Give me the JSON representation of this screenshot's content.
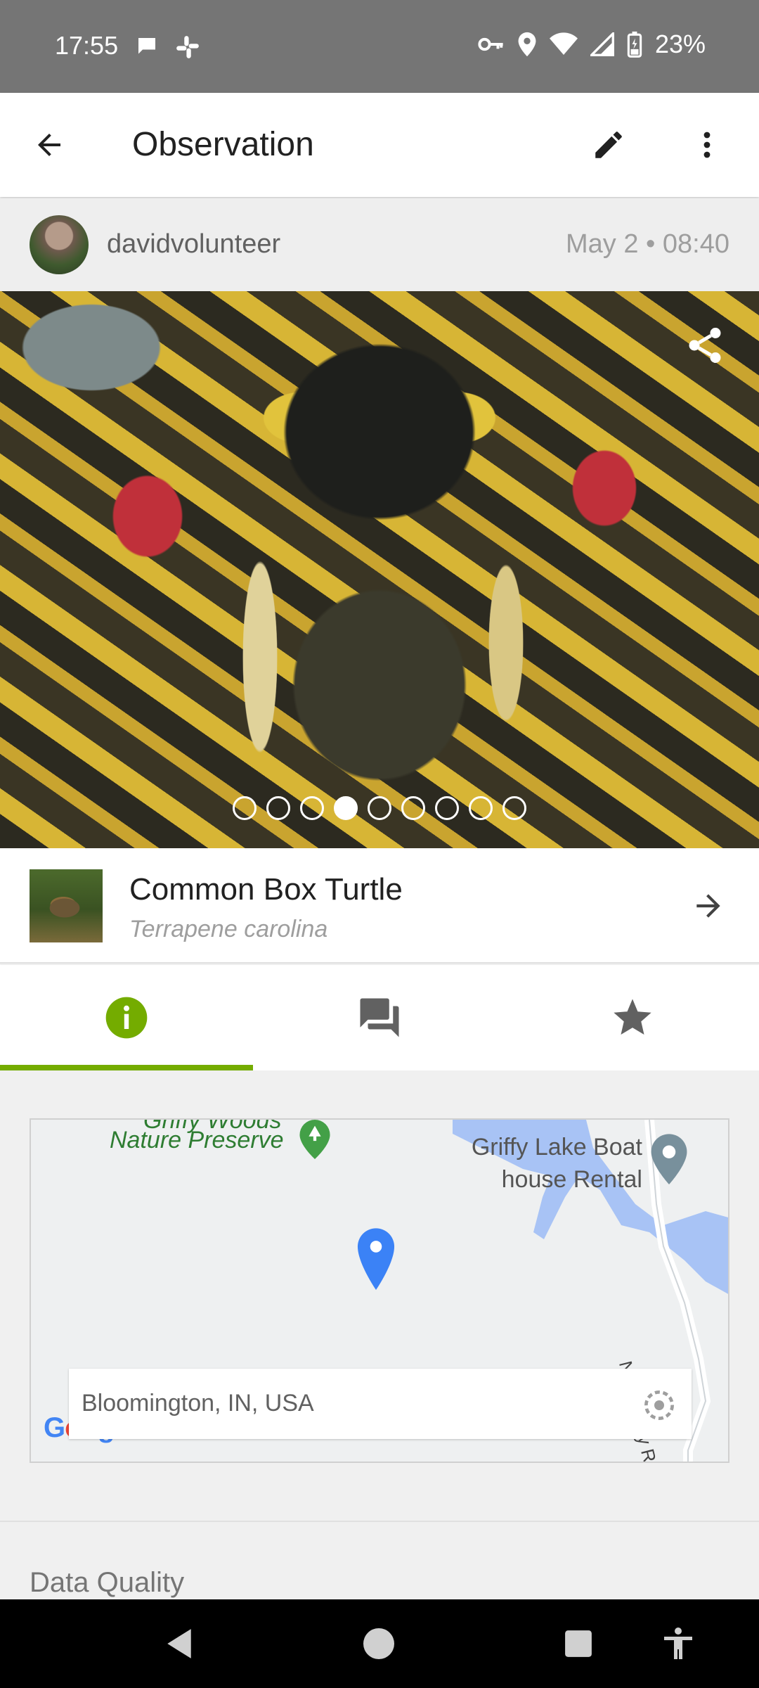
{
  "status_bar": {
    "time": "17:55",
    "battery": "23%"
  },
  "app_bar": {
    "title": "Observation"
  },
  "observation": {
    "username": "davidvolunteer",
    "date": "May 2 • 08:40"
  },
  "photo": {
    "count": 9,
    "active_index": 3
  },
  "taxon": {
    "common_name": "Common Box Turtle",
    "scientific_name": "Terrapene carolina"
  },
  "tabs": [
    {
      "name": "info",
      "icon": "info-icon",
      "active": true
    },
    {
      "name": "activity",
      "icon": "comments-icon",
      "active": false
    },
    {
      "name": "favorites",
      "icon": "star-icon",
      "active": false
    }
  ],
  "map": {
    "label_park_top": "Griffy Woods",
    "label_park": "Nature Preserve",
    "label_rental_line1": "Griffy Lake Boat",
    "label_rental_line2": "house Rental",
    "label_road": "N Headley Rd",
    "location": "Bloomington, IN, USA",
    "google": "Google"
  },
  "sections": {
    "data_quality_title": "Data Quality"
  },
  "colors": {
    "accent": "#74ac00",
    "status_bar": "#757575",
    "map_water": "#a8c3f5",
    "pin": "#3b82f6"
  }
}
